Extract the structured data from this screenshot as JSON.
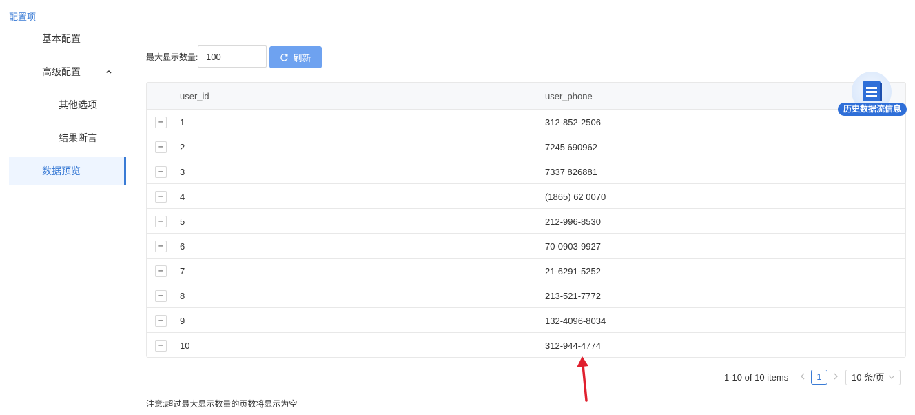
{
  "breadcrumb": "配置项",
  "sidebar": {
    "items": [
      {
        "label": "基本配置"
      },
      {
        "label": "高级配置"
      },
      {
        "label": "其他选项"
      },
      {
        "label": "结果断言"
      },
      {
        "label": "数据预览"
      }
    ],
    "expand_icon": "chevron-up-icon",
    "active_index": 4
  },
  "controls": {
    "max_label": "最大显示数量:",
    "max_value": "100",
    "refresh_label": "刷新",
    "refresh_icon": "refresh-icon"
  },
  "table": {
    "columns": [
      "user_id",
      "user_phone"
    ],
    "rows": [
      {
        "user_id": "1",
        "user_phone": "312-852-2506"
      },
      {
        "user_id": "2",
        "user_phone": "7245 690962"
      },
      {
        "user_id": "3",
        "user_phone": "7337 826881"
      },
      {
        "user_id": "4",
        "user_phone": "(1865) 62 0070"
      },
      {
        "user_id": "5",
        "user_phone": "212-996-8530"
      },
      {
        "user_id": "6",
        "user_phone": "70-0903-9927"
      },
      {
        "user_id": "7",
        "user_phone": "21-6291-5252"
      },
      {
        "user_id": "8",
        "user_phone": "213-521-7772"
      },
      {
        "user_id": "9",
        "user_phone": "132-4096-8034"
      },
      {
        "user_id": "10",
        "user_phone": "312-944-4774"
      }
    ],
    "expand_symbol": "+"
  },
  "float_button": {
    "label": "历史数据流信息",
    "icon": "document-icon"
  },
  "pagination": {
    "info": "1-10 of 10 items",
    "current_page": "1",
    "page_size": "10 条/页",
    "prev_icon": "chevron-left-icon",
    "next_icon": "chevron-right-icon"
  },
  "note": "注意:超过最大显示数量的页数将显示为空",
  "colors": {
    "accent": "#3a7bd5",
    "button": "#6ea2f0",
    "annotation_arrow": "#e0202e"
  }
}
